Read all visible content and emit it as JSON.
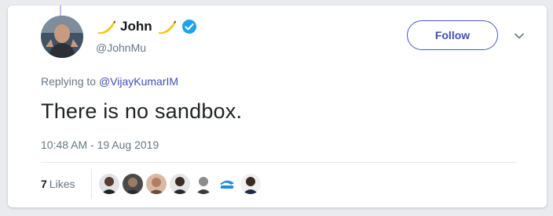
{
  "author": {
    "display_name": "John",
    "handle": "@JohnMu",
    "emoji_left": "banana",
    "emoji_right": "banana",
    "verified_icon": "verified-badge-icon"
  },
  "follow_button": {
    "label": "Follow"
  },
  "more_menu": {
    "icon": "chevron-down-icon"
  },
  "reply": {
    "prefix": "Replying to",
    "mention": "@VijayKumarIM"
  },
  "tweet": {
    "text": "There is no sandbox.",
    "timestamp": "10:48 AM - 19 Aug 2019"
  },
  "likes": {
    "count": "7",
    "label": "Likes"
  },
  "colors": {
    "accent": "#3f4fbe",
    "verified": "#1da1f2",
    "muted": "#657786"
  }
}
